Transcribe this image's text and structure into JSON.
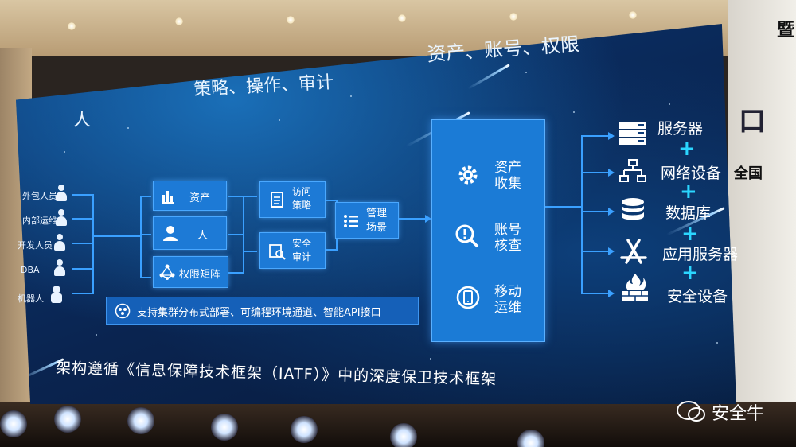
{
  "slide": {
    "top_right_heading": "资产、账号、权限",
    "top_left_heading": "策略、操作、审计",
    "person_heading": "人",
    "people": [
      "外包人员",
      "内部运维",
      "开发人员",
      "DBA",
      "机器人"
    ],
    "left_boxes": [
      "资产",
      "人",
      "权限矩阵"
    ],
    "mid_boxes": [
      "访问\n策略",
      "安全\n审计"
    ],
    "manage_box": "管理\n场景",
    "panel_items": [
      "资产\n收集",
      "账号\n核查",
      "移动\n运维"
    ],
    "resources": [
      "服务器",
      "网络设备",
      "数据库",
      "应用服务器",
      "安全设备"
    ],
    "info_bar": "支持集群分布式部署、可编程环境通道、智能API接口",
    "footer": "架构遵循《信息保障技术框架（IATF）》中的深度保卫技术框架"
  },
  "watermark": {
    "label": "安全牛",
    "icon": "wechat-icon"
  },
  "banner": {
    "b1": "暨",
    "b2": "口",
    "b3": "全国"
  },
  "colors": {
    "screen_blue": "#0b3a78",
    "box_blue": "#1d7ad6",
    "accent_cyan": "#2bd6ff"
  }
}
